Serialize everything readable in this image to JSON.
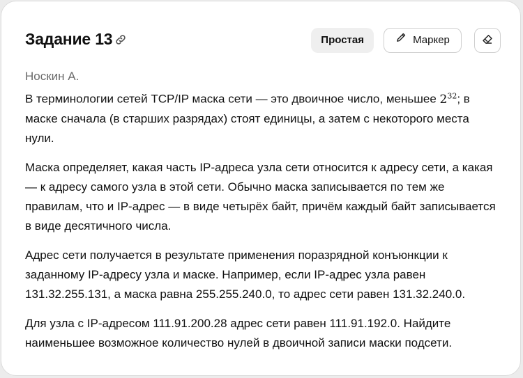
{
  "task": {
    "title": "Задание 13",
    "difficulty": "Простая",
    "marker_label": "Маркер"
  },
  "author": "Носкин А.",
  "paragraphs": {
    "p1_before": "В терминологии сетей TCP/IP маска сети — это двоичное число, меньшее ",
    "p1_base": "2",
    "p1_exp": "32",
    "p1_after": ";",
    "p1_line2": "в маске сначала (в старших разрядах) стоят единицы, а затем с некоторого места нули.",
    "p2": "Маска определяет, какая часть IP-адреса узла сети относится к адресу сети, а какая — к адресу самого узла в этой сети. Обычно маска записывается по тем же правилам, что и IP-адрес — в виде четырёх байт, причём каждый байт записывается в виде десятичного числа.",
    "p3": "Адрес сети получается в результате применения поразрядной конъюнкции к заданному IP-адресу узла и маске. Например, если IP-адрес узла равен 131.32.255.131, а маска равна 255.255.240.0, то адрес сети равен 131.32.240.0.",
    "p4": "Для узла с IP-адресом 111.91.200.28 адрес сети равен 111.91.192.0. Найдите наименьшее возможное количество нулей в двоичной записи маски подсети."
  }
}
